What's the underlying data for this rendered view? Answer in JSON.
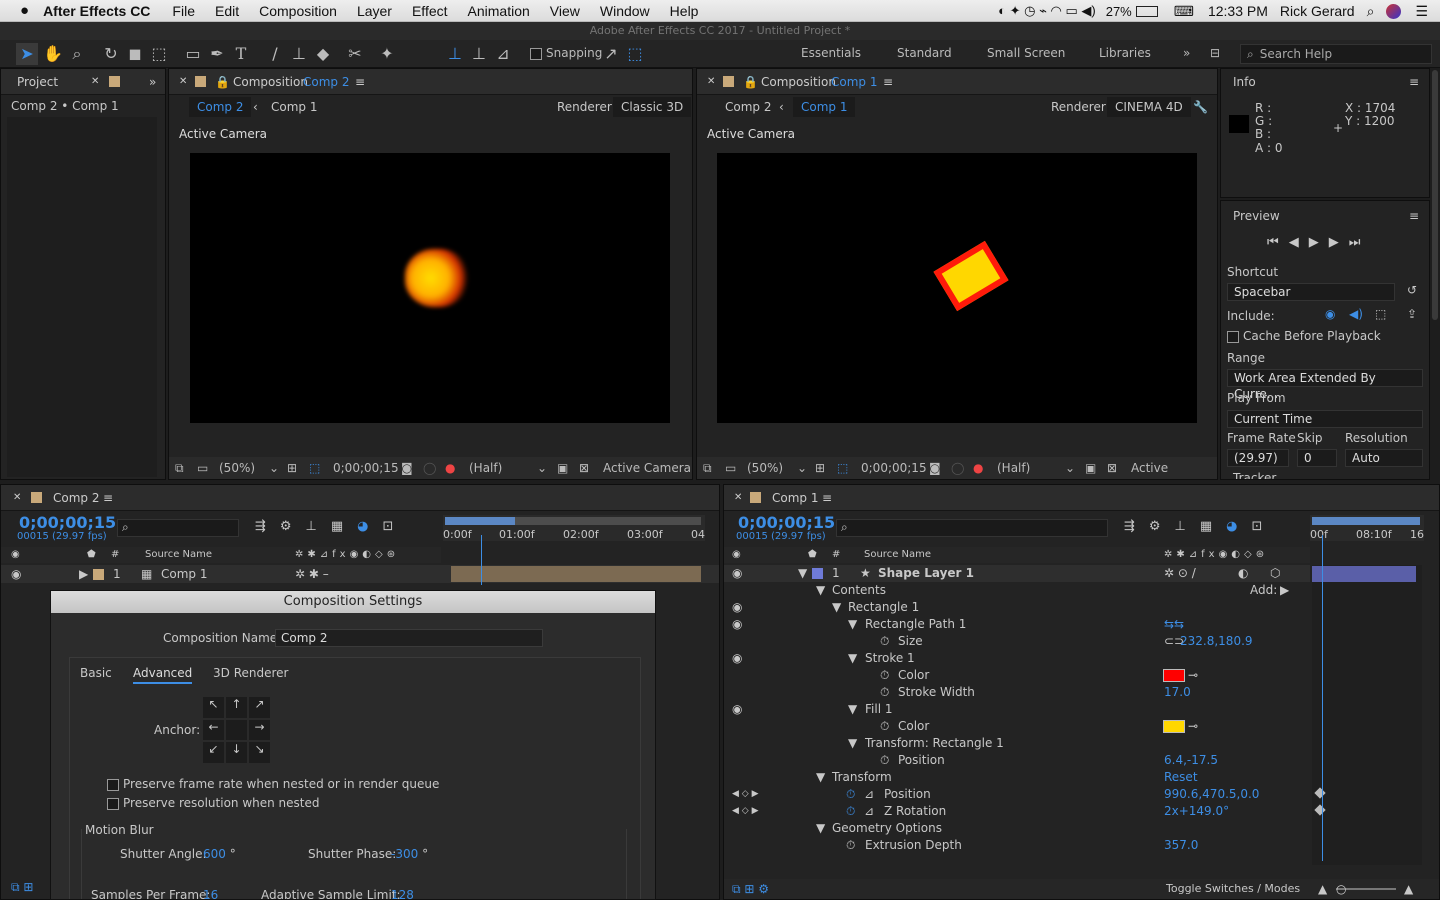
{
  "menubar": {
    "app": "After Effects CC",
    "items": [
      "File",
      "Edit",
      "Composition",
      "Layer",
      "Effect",
      "Animation",
      "View",
      "Window",
      "Help"
    ],
    "battery": "27%",
    "time": "12:33 PM",
    "user": "Rick Gerard"
  },
  "window_title": "Adobe After Effects CC 2017 - Untitled Project *",
  "toolbar": {
    "snapping": "Snapping",
    "workspaces": [
      "Essentials",
      "Standard",
      "Small Screen",
      "Libraries"
    ],
    "search": "Search Help"
  },
  "project": {
    "tab": "Project",
    "crumb": "Comp 2 • Comp 1"
  },
  "viewer1": {
    "tab_prefix": "Composition",
    "tab_name": "Comp 2",
    "crumb_active": "Comp 2",
    "crumb_other": "Comp 1",
    "renderer_label": "Renderer:",
    "renderer": "Classic 3D",
    "camera_label": "Active Camera",
    "zoom": "(50%)",
    "time": "0;00;00;15",
    "res": "(Half)",
    "view": "Active Camera"
  },
  "viewer2": {
    "tab_prefix": "Composition",
    "tab_name": "Comp 1",
    "crumb_other": "Comp 2",
    "crumb_active": "Comp 1",
    "renderer_label": "Renderer:",
    "renderer": "CINEMA 4D",
    "camera_label": "Active Camera",
    "zoom": "(50%)",
    "time": "0;00;00;15",
    "res": "(Half)",
    "view": "Active Camera"
  },
  "info": {
    "title": "Info",
    "r": "R :",
    "g": "G :",
    "b": "B :",
    "a": "A : 0",
    "x": "X : 1704",
    "y": "Y : 1200"
  },
  "preview": {
    "title": "Preview",
    "shortcut_label": "Shortcut",
    "shortcut": "Spacebar",
    "include_label": "Include:",
    "cache": "Cache Before Playback",
    "range_label": "Range",
    "range": "Work Area Extended By Curre...",
    "playfrom_label": "Play From",
    "playfrom": "Current Time",
    "framerate_label": "Frame Rate",
    "skip_label": "Skip",
    "resolution_label": "Resolution",
    "framerate": "(29.97)",
    "skip": "0",
    "resolution": "Auto",
    "tracker": "Tracker"
  },
  "timeline1": {
    "tab": "Comp 2",
    "time": "0;00;00;15",
    "fps": "00015 (29.97 fps)",
    "col_num": "#",
    "col_source": "Source Name",
    "ruler": [
      "0:00f",
      "01:00f",
      "02:00f",
      "03:00f",
      "04"
    ],
    "layer_num": "1",
    "layer_name": "Comp 1"
  },
  "timeline2": {
    "tab": "Comp 1",
    "time": "0;00;00;15",
    "fps": "00015 (29.97 fps)",
    "col_num": "#",
    "col_source": "Source Name",
    "ruler": [
      "00f",
      "08:10f",
      "16"
    ],
    "add_label": "Add:",
    "toggle": "Toggle Switches / Modes",
    "rows": [
      {
        "name": "Shape Layer 1",
        "num": "1",
        "value": ""
      },
      {
        "name": "Contents",
        "value": ""
      },
      {
        "name": "Rectangle 1",
        "value": ""
      },
      {
        "name": "Rectangle Path 1",
        "value": ""
      },
      {
        "name": "Size",
        "value": "232.8,180.9"
      },
      {
        "name": "Stroke 1",
        "value": ""
      },
      {
        "name": "Color",
        "value": ""
      },
      {
        "name": "Stroke Width",
        "value": "17.0"
      },
      {
        "name": "Fill 1",
        "value": ""
      },
      {
        "name": "Color",
        "value": ""
      },
      {
        "name": "Transform: Rectangle 1",
        "value": ""
      },
      {
        "name": "Position",
        "value": "6.4,-17.5"
      },
      {
        "name": "Transform",
        "value": "Reset"
      },
      {
        "name": "Position",
        "value": "990.6,470.5,0.0"
      },
      {
        "name": "Z Rotation",
        "value": "2x+149.0°"
      },
      {
        "name": "Geometry Options",
        "value": ""
      },
      {
        "name": "Extrusion Depth",
        "value": "357.0"
      }
    ],
    "stroke_color": "#ff0000",
    "fill_color": "#ffd700"
  },
  "dialog": {
    "title": "Composition Settings",
    "name_label": "Composition Name:",
    "name": "Comp 2",
    "tabs": [
      "Basic",
      "Advanced",
      "3D Renderer"
    ],
    "anchor_label": "Anchor:",
    "preserve_fps": "Preserve frame rate when nested or in render queue",
    "preserve_res": "Preserve resolution when nested",
    "motion_blur": "Motion Blur",
    "shutter_angle_label": "Shutter Angle:",
    "shutter_angle": "600",
    "shutter_phase_label": "Shutter Phase:",
    "shutter_phase": "-300",
    "samples_label": "Samples Per Frame:",
    "samples": "16",
    "adaptive_label": "Adaptive Sample Limit:",
    "adaptive": "128",
    "deg": "°"
  }
}
